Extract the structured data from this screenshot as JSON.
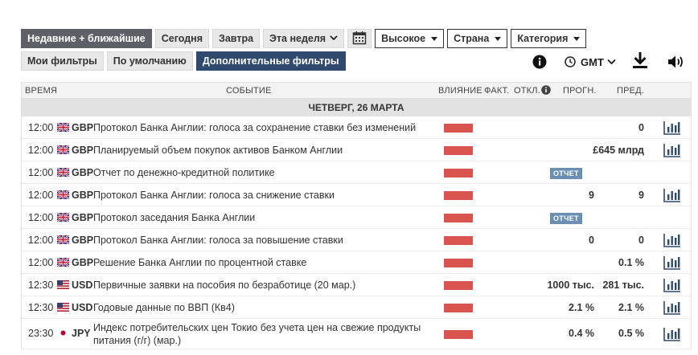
{
  "filters": {
    "recent": "Недавние + ближайшие",
    "today": "Сегодня",
    "tomorrow": "Завтра",
    "this_week": "Эта неделя",
    "importance": "Высокое",
    "country": "Страна",
    "category": "Категория",
    "my_filters": "Мои фильтры",
    "default": "По умолчанию",
    "extra": "Дополнительные фильтры"
  },
  "tools": {
    "timezone": "GMT"
  },
  "table": {
    "headers": {
      "time": "ВРЕМЯ",
      "event": "СОБЫТИЕ",
      "impact": "ВЛИЯНИЕ",
      "actual": "ФАКТ.",
      "deviation": "ОТКЛ.",
      "forecast": "ПРОГН.",
      "previous": "ПРЕД."
    },
    "day": "ЧЕТВЕРГ, 26 МАРТА",
    "rows": [
      {
        "time": "12:00",
        "currency": "GBP",
        "event": "Протокол Банка Англии: голоса за сохранение ставки без изменений",
        "forecast": "",
        "previous": "0",
        "badge": ""
      },
      {
        "time": "12:00",
        "currency": "GBP",
        "event": "Планируемый объем покупок активов Банком Англии",
        "forecast": "",
        "previous": "£645 млрд",
        "badge": ""
      },
      {
        "time": "12:00",
        "currency": "GBP",
        "event": "Отчет по денежно-кредитной политике",
        "forecast": "",
        "previous": "",
        "badge": "ОТЧЕТ"
      },
      {
        "time": "12:00",
        "currency": "GBP",
        "event": "Протокол Банка Англии: голоса за снижение ставки",
        "forecast": "9",
        "previous": "9",
        "badge": ""
      },
      {
        "time": "12:00",
        "currency": "GBP",
        "event": "Протокол заседания Банка Англии",
        "forecast": "",
        "previous": "",
        "badge": "ОТЧЕТ"
      },
      {
        "time": "12:00",
        "currency": "GBP",
        "event": "Протокол Банка Англии: голоса за повышение ставки",
        "forecast": "0",
        "previous": "0",
        "badge": ""
      },
      {
        "time": "12:00",
        "currency": "GBP",
        "event": "Решение Банка Англии по процентной ставке",
        "forecast": "",
        "previous": "0.1 %",
        "badge": ""
      },
      {
        "time": "12:30",
        "currency": "USD",
        "event": "Первичные заявки на пособия по безработице (20 мар.)",
        "forecast": "1000 тыс.",
        "previous": "281 тыс.",
        "badge": ""
      },
      {
        "time": "12:30",
        "currency": "USD",
        "event": "Годовые данные по ВВП (Кв4)",
        "forecast": "2.1 %",
        "previous": "2.1 %",
        "badge": ""
      },
      {
        "time": "23:30",
        "currency": "JPY",
        "event": "Индекс потребительских цен Токио без учета цен на свежие продукты питания (г/г) (мар.)",
        "forecast": "0.4 %",
        "previous": "0.5 %",
        "badge": ""
      }
    ]
  },
  "colors": {
    "impact_high": "#d9534f",
    "report_badge": "#6a8fb3",
    "active_filter": "#2f4a6e"
  }
}
